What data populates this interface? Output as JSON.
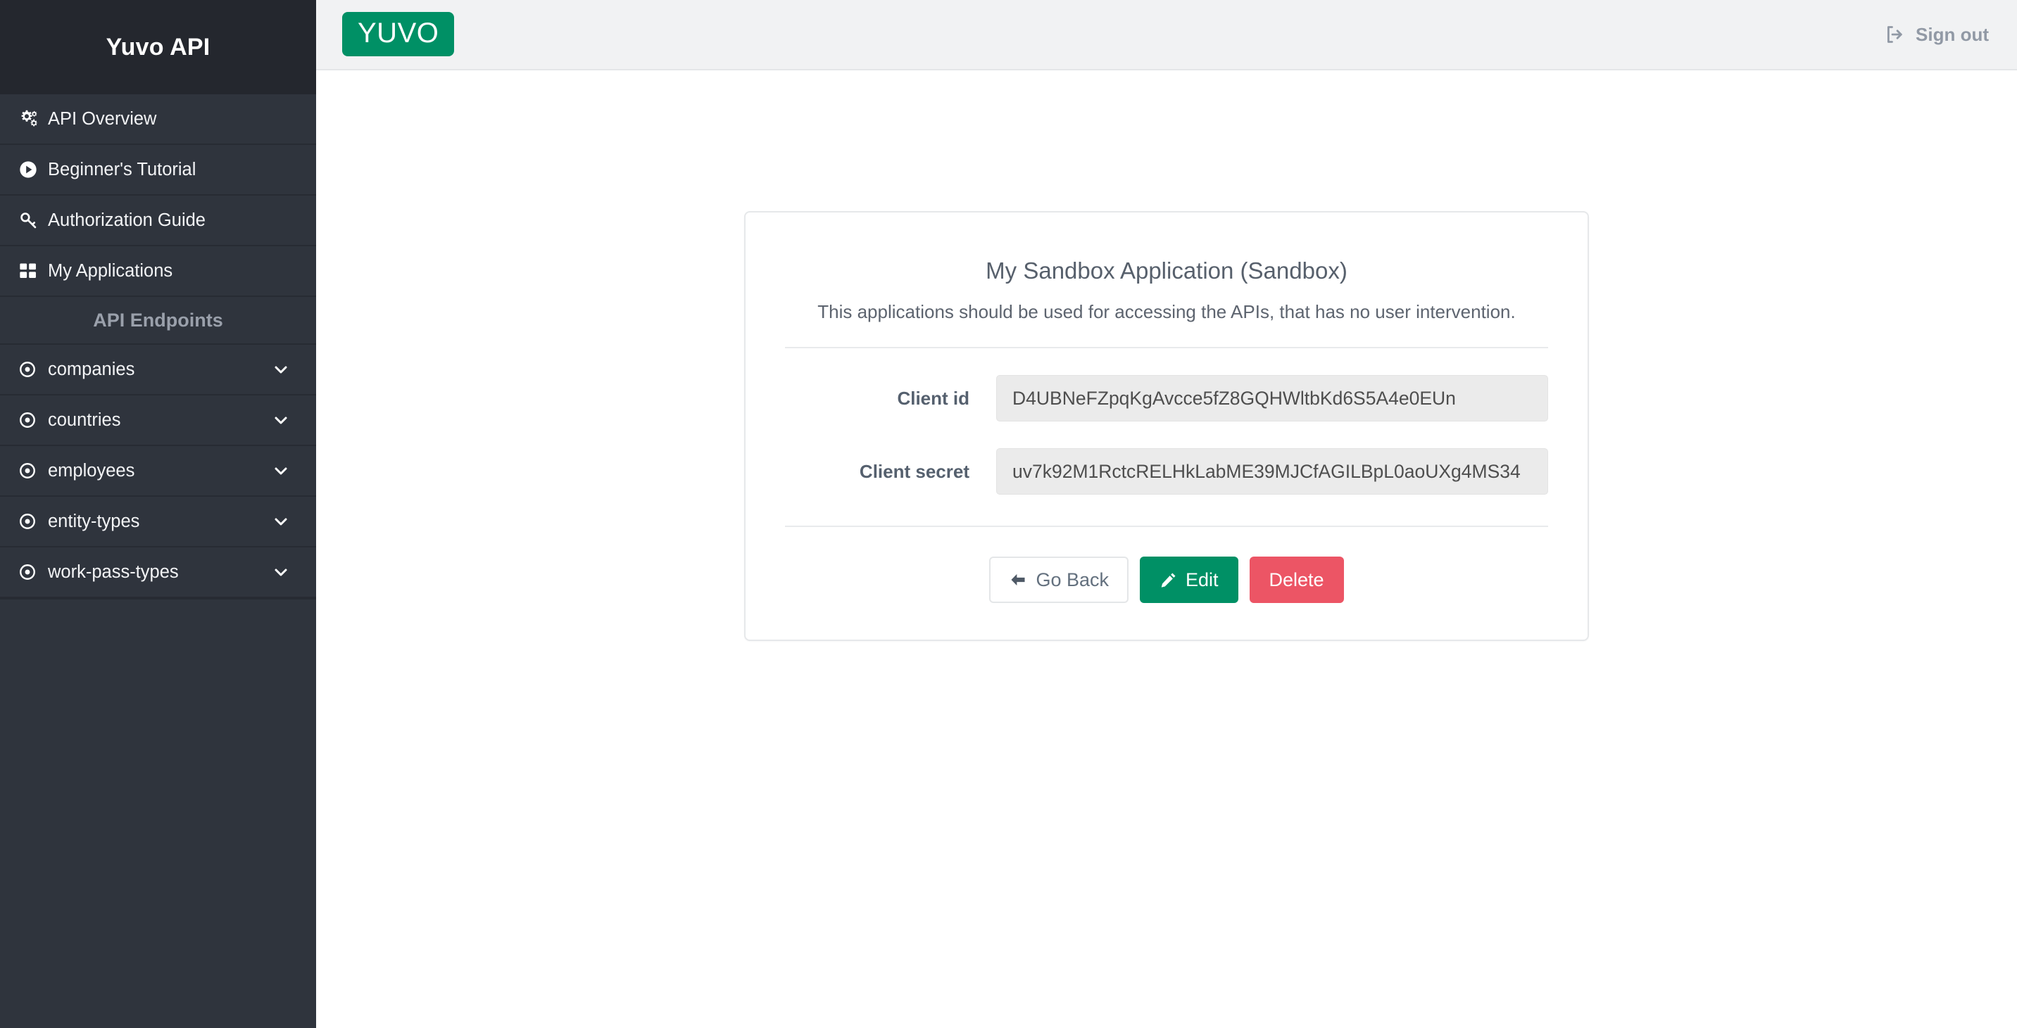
{
  "sidebar": {
    "brand": "Yuvo API",
    "items": [
      {
        "label": "API Overview",
        "icon": "cogs-icon"
      },
      {
        "label": "Beginner's Tutorial",
        "icon": "play-circle-icon"
      },
      {
        "label": "Authorization Guide",
        "icon": "key-icon"
      },
      {
        "label": "My Applications",
        "icon": "grid-icon"
      }
    ],
    "section_title": "API Endpoints",
    "endpoints": [
      {
        "label": "companies",
        "icon": "dot-circle-icon",
        "caret": "chevron-down-icon"
      },
      {
        "label": "countries",
        "icon": "dot-circle-icon",
        "caret": "chevron-down-icon"
      },
      {
        "label": "employees",
        "icon": "dot-circle-icon",
        "caret": "chevron-down-icon"
      },
      {
        "label": "entity-types",
        "icon": "dot-circle-icon",
        "caret": "chevron-down-icon"
      },
      {
        "label": "work-pass-types",
        "icon": "dot-circle-icon",
        "caret": "chevron-down-icon"
      }
    ]
  },
  "topbar": {
    "logo_text": "YUVO",
    "logo_color": "#009065",
    "signout_label": "Sign out",
    "signout_icon": "sign-out-icon"
  },
  "card": {
    "title": "My Sandbox Application (Sandbox)",
    "subtitle": "This applications should be used for accessing the APIs, that has no user intervention.",
    "fields": [
      {
        "label": "Client id",
        "value": "D4UBNeFZpqKgAvcce5fZ8GQHWltbKd6S5A4e0EUn"
      },
      {
        "label": "Client secret",
        "value": "uv7k92M1RctcRELHkLabME39MJCfAGILBpL0aoUXg4MS34"
      }
    ],
    "buttons": [
      {
        "label": "Go Back",
        "icon": "arrow-left-icon",
        "style": "default",
        "color": "#ffffff"
      },
      {
        "label": "Edit",
        "icon": "pencil-icon",
        "style": "primary",
        "color": "#009065"
      },
      {
        "label": "Delete",
        "icon": "none",
        "style": "danger",
        "color": "#ec5565"
      }
    ]
  }
}
